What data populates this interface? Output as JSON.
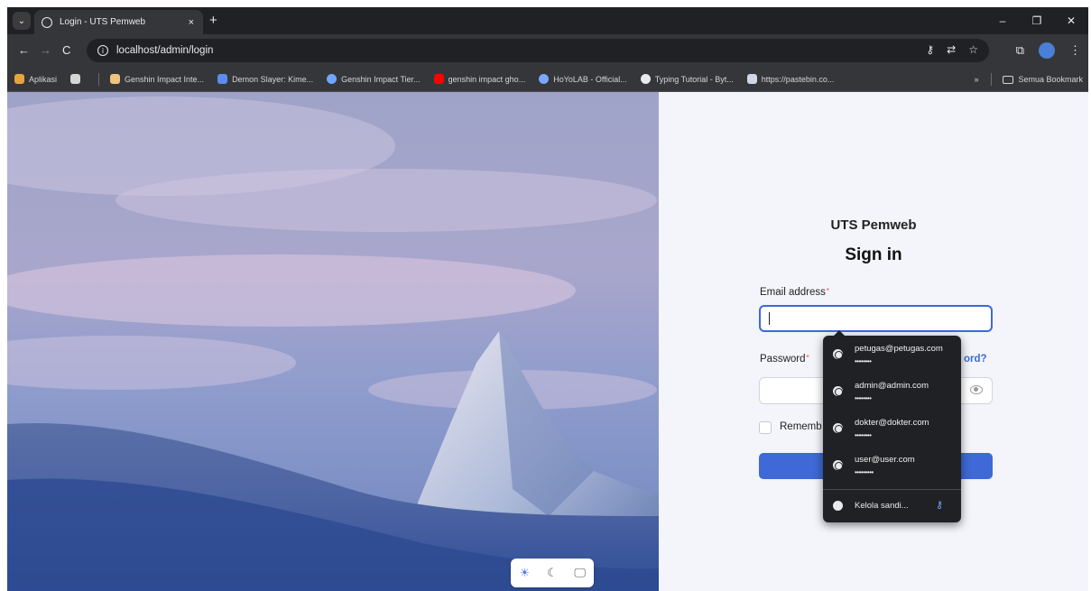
{
  "browser": {
    "tab_title": "Login - UTS Pemweb",
    "tab_close": "×",
    "new_tab": "+",
    "tab_menu": "⌄",
    "window_controls": {
      "minimize": "–",
      "maximize": "❐",
      "close": "✕"
    },
    "url": "localhost/admin/login",
    "nav": {
      "back": "←",
      "forward": "→",
      "reload": "C"
    }
  },
  "bookmarks": {
    "items": [
      {
        "label": "Aplikasi",
        "color": "#e8a33b"
      },
      {
        "label": "Genshin Impact Inte...",
        "color": "#f1c27d"
      },
      {
        "label": "Demon Slayer: Kime...",
        "color": "#5a8dee"
      },
      {
        "label": "Genshin Impact Tier...",
        "color": "#6fa6ff"
      },
      {
        "label": "genshin impact gho...",
        "color": "#ff0000"
      },
      {
        "label": "HoYoLAB - Official...",
        "color": "#7aa7ff"
      },
      {
        "label": "Typing Tutorial - Byt...",
        "color": "#e8eaed"
      },
      {
        "label": "https://pastebin.co...",
        "color": "#cfd6e6"
      }
    ],
    "more": "»",
    "all_bookmarks": "Semua Bookmark"
  },
  "login": {
    "app_name": "UTS Pemweb",
    "heading": "Sign in",
    "email_label": "Email address",
    "password_label": "Password",
    "required_mark": "*",
    "forgot_partial": "ord?",
    "remember_partial": "Rememb"
  },
  "autofill": {
    "credentials": [
      {
        "username": "petugas@petugas.com",
        "masked": "••••••••"
      },
      {
        "username": "admin@admin.com",
        "masked": "••••••••"
      },
      {
        "username": "dokter@dokter.com",
        "masked": "••••••••"
      },
      {
        "username": "user@user.com",
        "masked": "•••••••••"
      }
    ],
    "manage_label": "Kelola sandi..."
  },
  "theme_switch": {
    "light": "☀",
    "dark": "☾",
    "system": "🖵"
  },
  "colors": {
    "accent": "#3e69d6",
    "panel_bg": "#f3f5fb",
    "chrome_dark": "#202124"
  }
}
